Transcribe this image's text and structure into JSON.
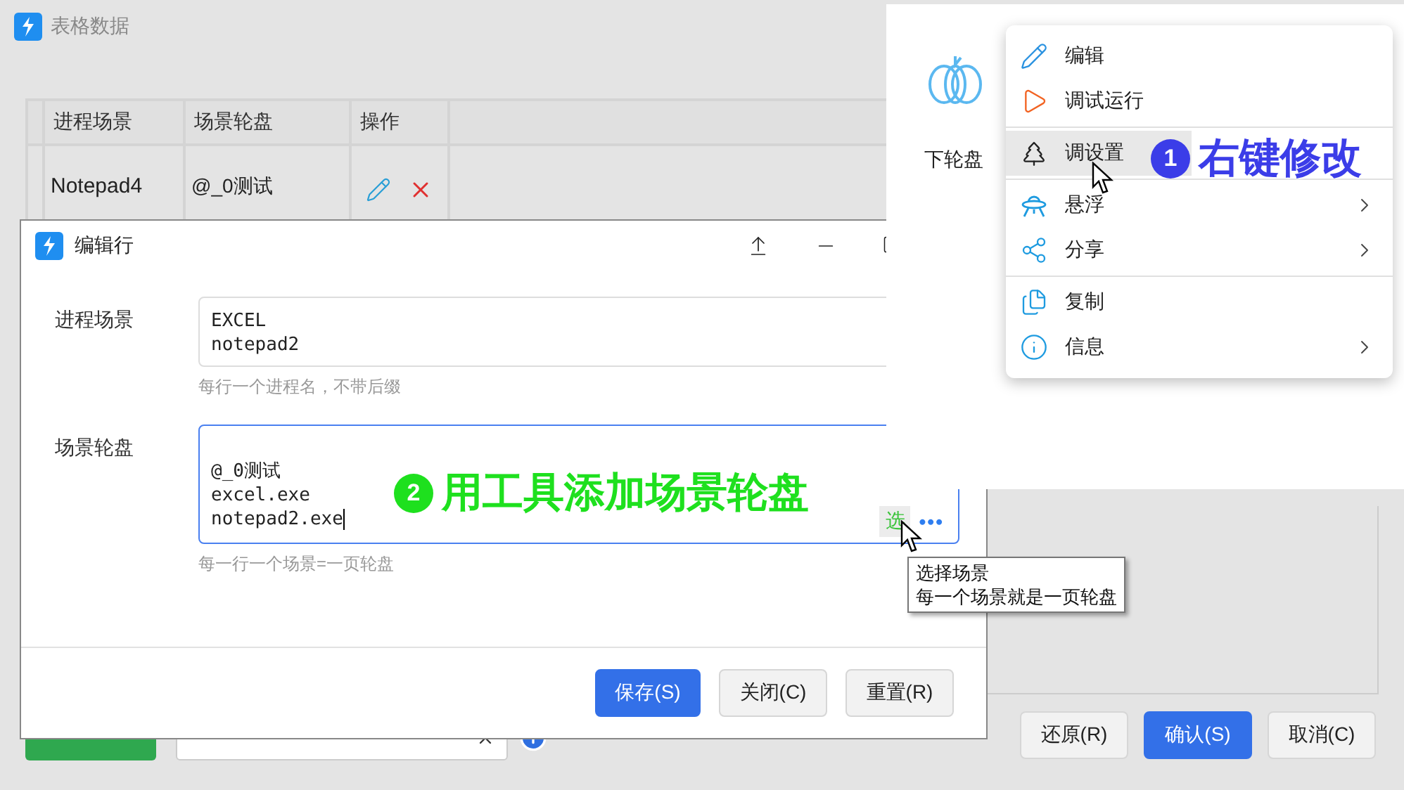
{
  "main_window": {
    "title": "表格数据",
    "table": {
      "columns": [
        "进程场景",
        "场景轮盘",
        "操作"
      ],
      "rows": [
        {
          "process": "Notepad4",
          "wheel": [
            "@_0测试"
          ]
        }
      ]
    },
    "buttons": [
      {
        "label": "还原(R)",
        "primary": false
      },
      {
        "label": "确认(S)",
        "primary": true
      },
      {
        "label": "取消(C)",
        "primary": false
      }
    ]
  },
  "dialog": {
    "title": "编辑行",
    "fields": [
      {
        "label": "进程场景",
        "lines": [
          "EXCEL",
          "notepad2"
        ],
        "hint": "每行一个进程名，不带后缀",
        "focused": false
      },
      {
        "label": "场景轮盘",
        "lines": [
          "@_0测试",
          "excel.exe",
          "notepad2.exe"
        ],
        "hint": "每一行一个场景=一页轮盘",
        "focused": true,
        "pick_button": "选",
        "more_button": "•••"
      }
    ],
    "buttons": [
      {
        "label": "保存(S)",
        "primary": true
      },
      {
        "label": "关闭(C)",
        "primary": false
      },
      {
        "label": "重置(R)",
        "primary": false
      }
    ]
  },
  "tooltip": [
    "选择场景",
    "每一个场景就是一页轮盘"
  ],
  "wheel_panel": {
    "label": "下轮盘",
    "menu": [
      [
        {
          "label": "编辑",
          "selected": false,
          "submenu": false
        },
        {
          "label": "调试运行",
          "selected": false,
          "submenu": false
        }
      ],
      [
        {
          "label": "调设置",
          "selected": true,
          "submenu": false
        }
      ],
      [
        {
          "label": "悬浮",
          "selected": false,
          "submenu": true
        },
        {
          "label": "分享",
          "selected": false,
          "submenu": true
        }
      ],
      [
        {
          "label": "复制",
          "selected": false,
          "submenu": false
        },
        {
          "label": "信息",
          "selected": false,
          "submenu": true
        }
      ]
    ]
  },
  "annotations": [
    {
      "number": "1",
      "text": "右键修改",
      "color": "#3b3de8"
    },
    {
      "number": "2",
      "text": "用工具添加场景轮盘",
      "color": "#1ee01e"
    }
  ]
}
